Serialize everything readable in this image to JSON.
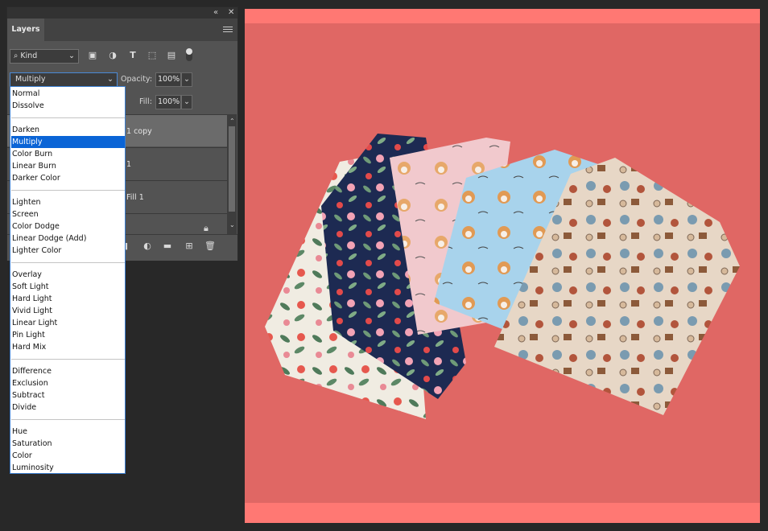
{
  "panel": {
    "collapse_icon": "«",
    "close_icon": "✕",
    "tab": "Layers",
    "filter": {
      "label": "Kind"
    },
    "blend": {
      "value": "Multiply"
    },
    "opacity": {
      "label": "Opacity:",
      "value": "100%"
    },
    "fill": {
      "label": "Fill:",
      "value": "100%"
    },
    "layers": [
      "1 copy",
      "1",
      "Fill 1"
    ]
  },
  "blend_modes": {
    "normal": "Normal",
    "dissolve": "Dissolve",
    "darken": "Darken",
    "multiply": "Multiply",
    "color_burn": "Color Burn",
    "linear_burn": "Linear Burn",
    "darker_color": "Darker Color",
    "lighten": "Lighten",
    "screen": "Screen",
    "color_dodge": "Color Dodge",
    "linear_dodge": "Linear Dodge (Add)",
    "lighter_color": "Lighter Color",
    "overlay": "Overlay",
    "soft_light": "Soft Light",
    "hard_light": "Hard Light",
    "vivid_light": "Vivid Light",
    "linear_light": "Linear Light",
    "pin_light": "Pin Light",
    "hard_mix": "Hard Mix",
    "difference": "Difference",
    "exclusion": "Exclusion",
    "subtract": "Subtract",
    "divide": "Divide",
    "hue": "Hue",
    "saturation": "Saturation",
    "color": "Color",
    "luminosity": "Luminosity"
  },
  "selected_mode": "Multiply",
  "colors": {
    "canvas": "#e06764",
    "accent": "#0a64d6",
    "band": "#ff7873"
  }
}
